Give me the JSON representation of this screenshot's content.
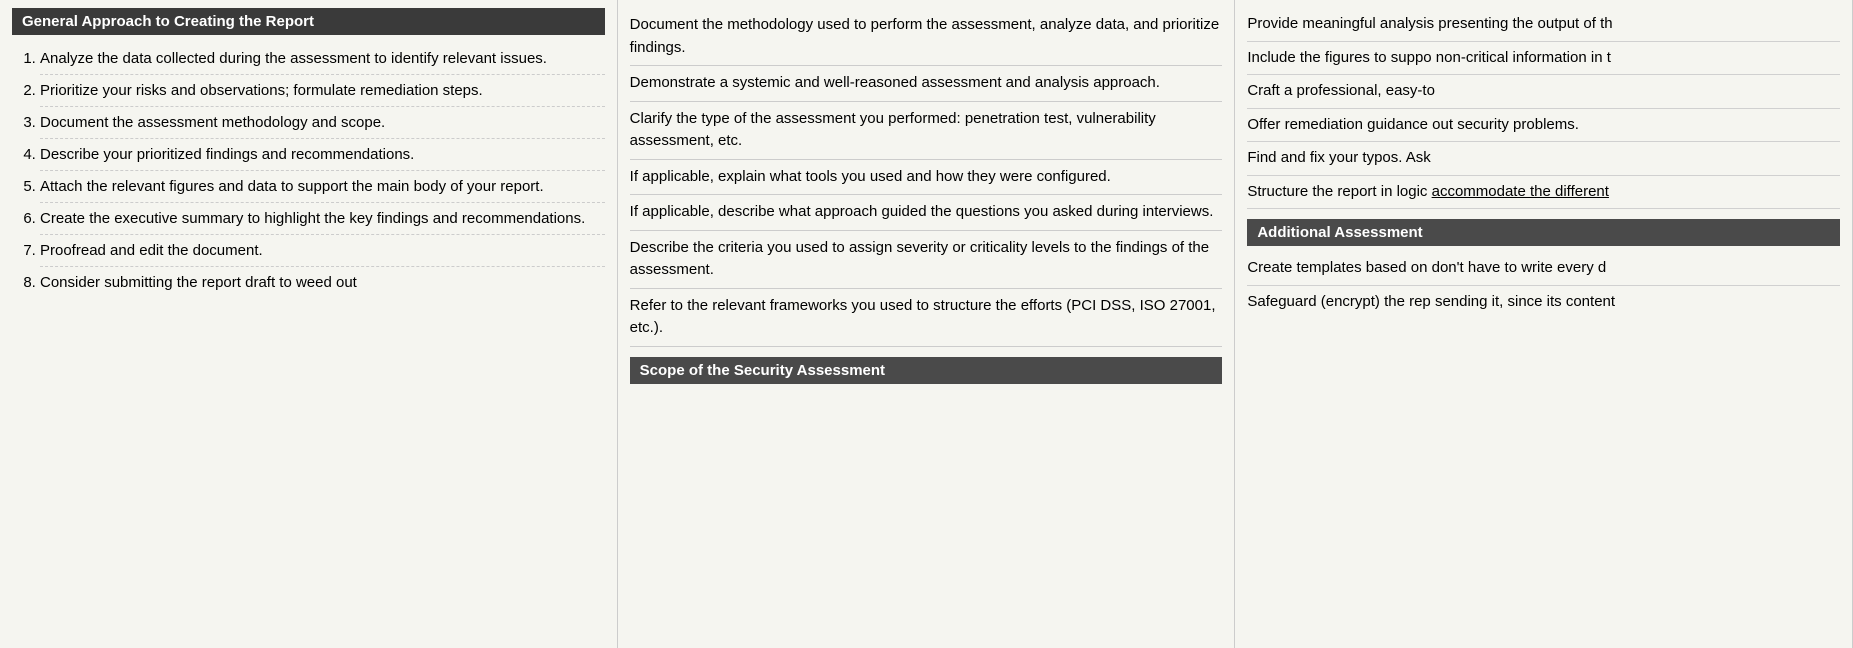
{
  "col1": {
    "header": "General Approach to Creating the Report",
    "items": [
      "Analyze the data collected during the assessment to identify relevant issues.",
      "Prioritize your risks and observations; formulate remediation steps.",
      "Document the assessment methodology and scope.",
      "Describe your prioritized findings and recommendations.",
      "Attach the relevant figures and data to support the main body of your report.",
      "Create the executive summary to highlight the key findings and recommendations.",
      "Proofread and edit the document.",
      "Consider submitting the report draft to weed out"
    ]
  },
  "col2": {
    "blocks": [
      "Document the methodology used to perform the assessment, analyze data, and prioritize findings.",
      "Demonstrate a systemic and well-reasoned assessment and analysis approach.",
      "Clarify the type of the assessment you performed: penetration test, vulnerability assessment, etc.",
      "If applicable, explain what tools you used and how they were configured.",
      "If applicable, describe what approach guided the questions you asked during interviews.",
      "Describe the criteria you used to assign severity or criticality levels to the findings of the assessment.",
      "Refer to the relevant frameworks you used to structure the efforts (PCI DSS, ISO 27001, etc.)."
    ],
    "sectionHeader": "Scope of the Security Assessment"
  },
  "col3": {
    "blocks": [
      "Provide meaningful analysis presenting the output of th",
      "Include the figures to suppo non-critical information in t",
      "Craft a professional, easy-to",
      "Offer remediation guidance out security problems.",
      "Find and fix your typos. Ask",
      {
        "text": "Structure the report in logic accommodate the different",
        "underline_part": "accommodate the different"
      }
    ],
    "sectionHeader": "Additional Assessment",
    "bottomBlocks": [
      "Create templates based on don't have to write every d",
      "Safeguard (encrypt) the rep sending it, since its content"
    ]
  }
}
